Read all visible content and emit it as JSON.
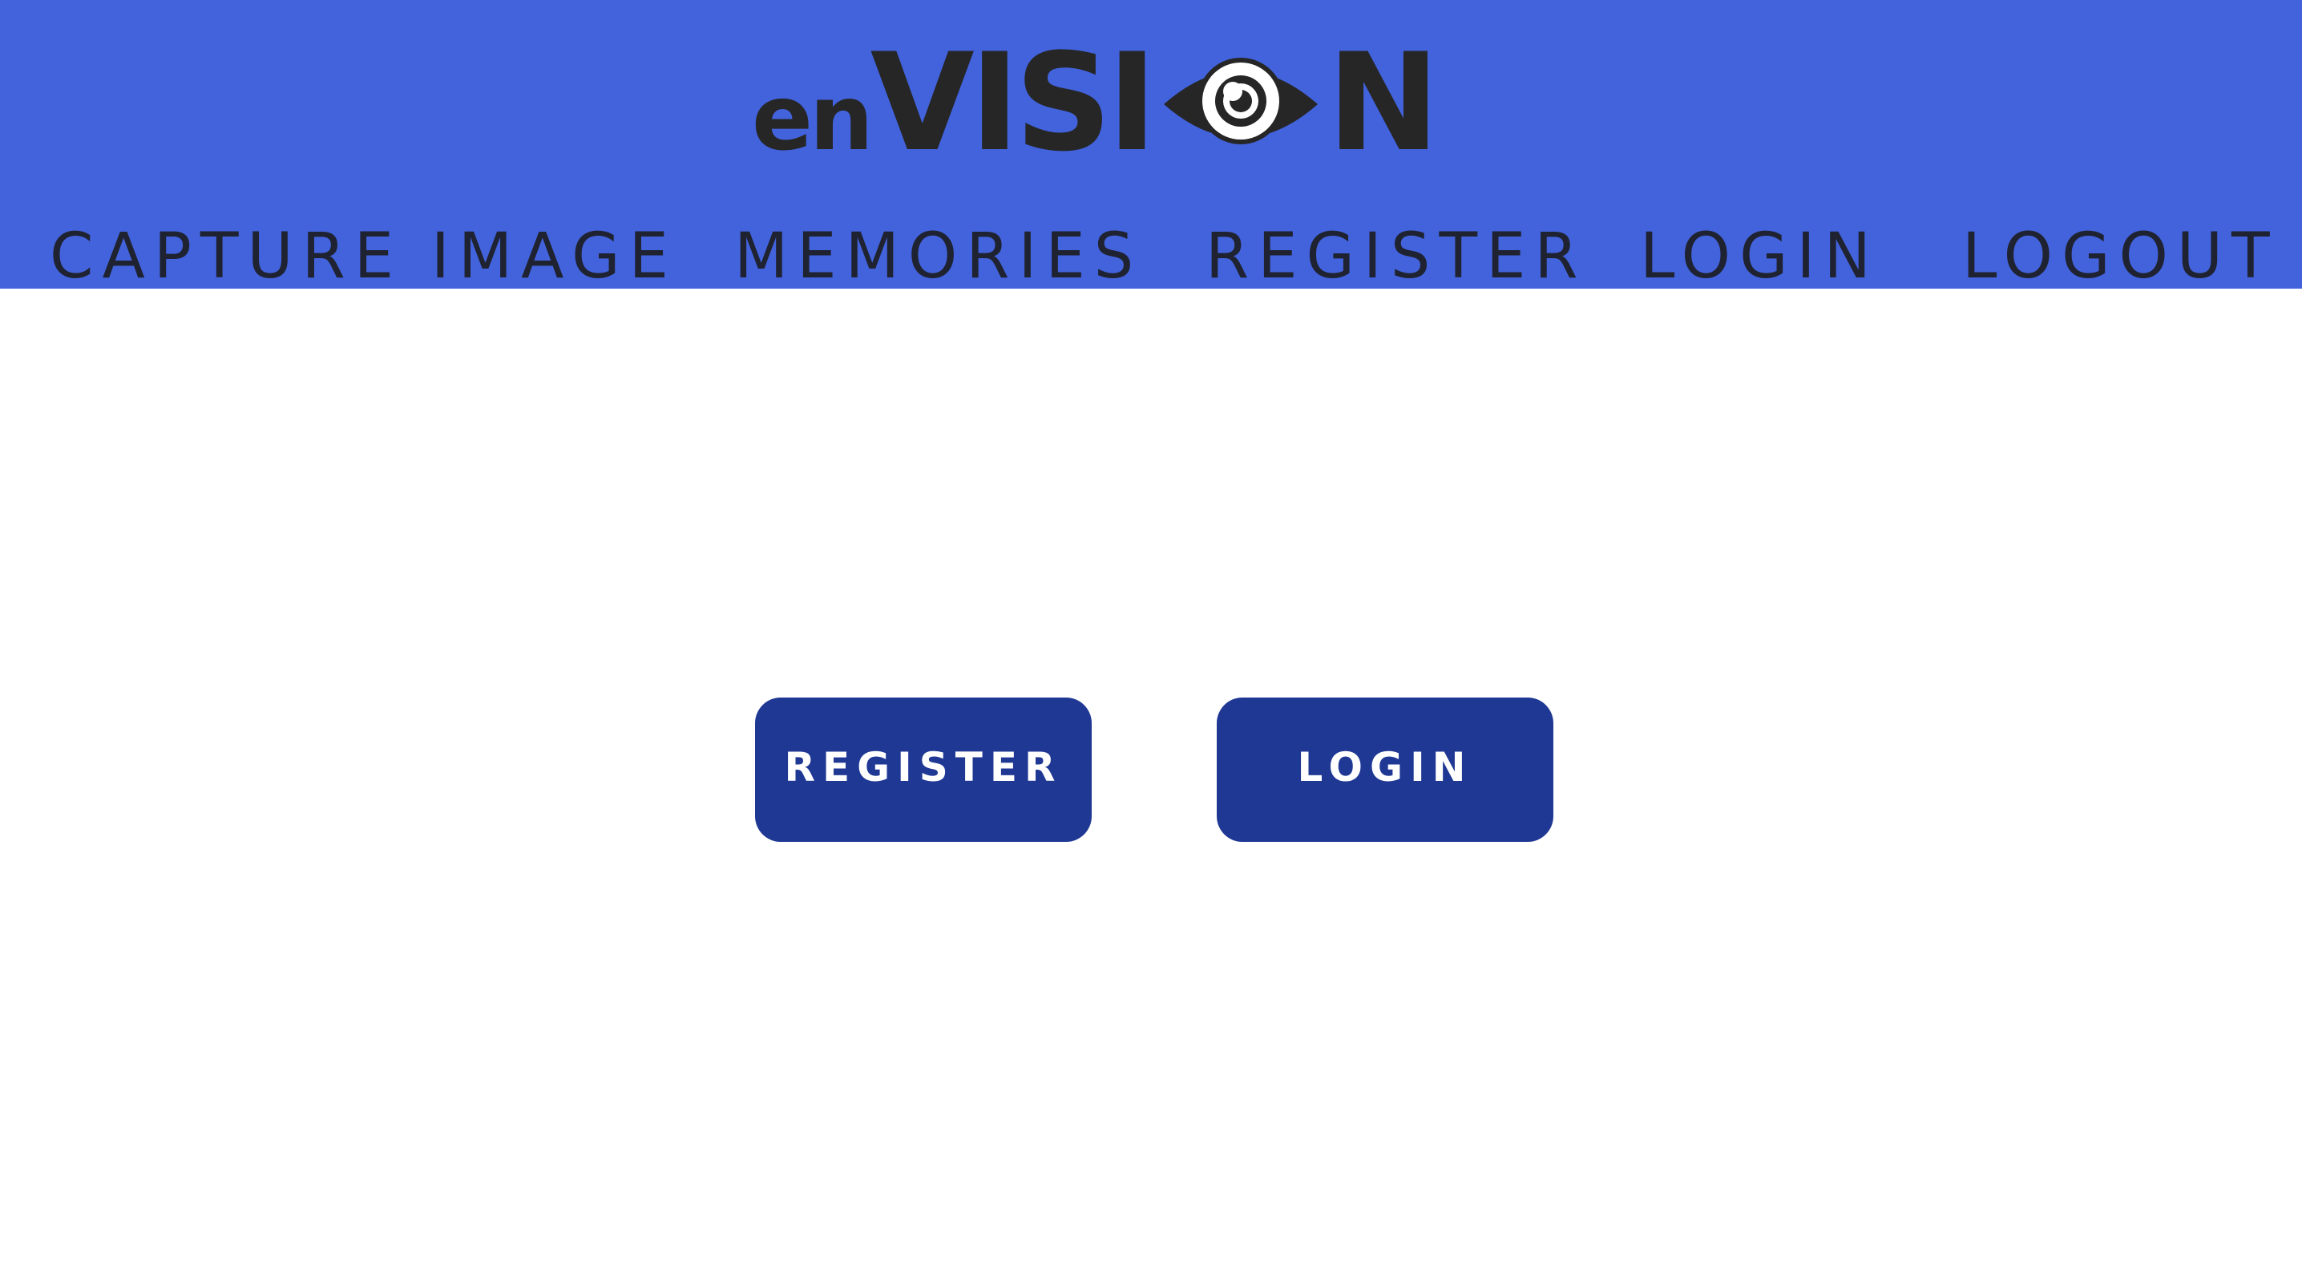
{
  "logo": {
    "prefix": "en",
    "word_start": "VISI",
    "word_end": "N",
    "eye_icon": "eye-icon",
    "colors": {
      "text": "#262626",
      "pupil": "#ffffff"
    }
  },
  "nav": {
    "items": [
      {
        "label": "CAPTURE IMAGE"
      },
      {
        "label": "MEMORIES"
      },
      {
        "label": "REGISTER"
      },
      {
        "label": "LOGIN"
      },
      {
        "label": "LOGOUT"
      }
    ]
  },
  "main": {
    "register_label": "REGISTER",
    "login_label": "LOGIN"
  },
  "colors": {
    "header_bg": "#4263dc",
    "button_bg": "#1f3894",
    "button_text": "#ffffff",
    "nav_text": "#1f2230",
    "page_bg": "#ffffff"
  }
}
